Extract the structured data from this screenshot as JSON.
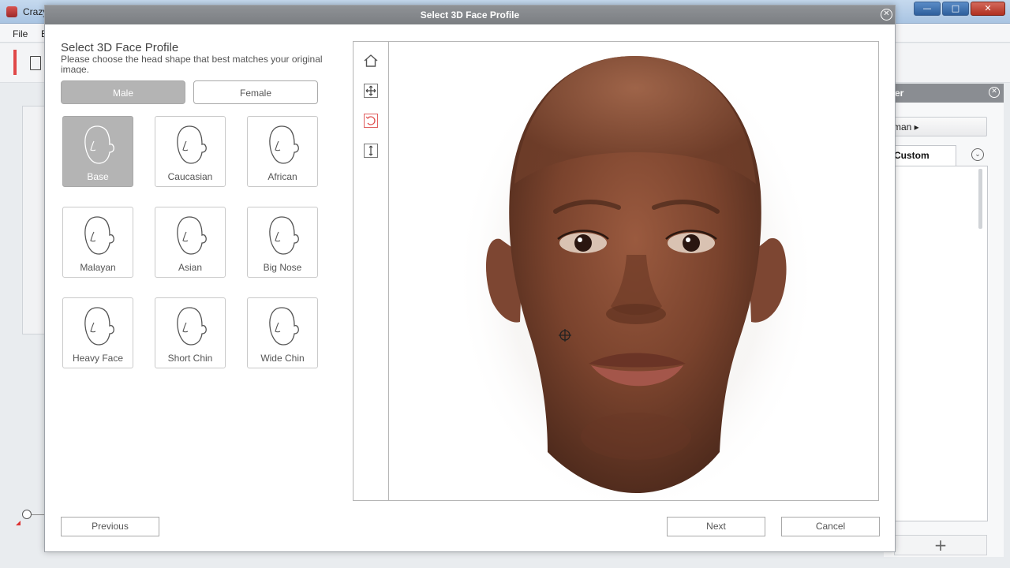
{
  "background_app": {
    "title": "Crazy",
    "menu": [
      "File",
      "E"
    ],
    "right_panel": {
      "title": "er",
      "dropdown_label": "man",
      "tab_label": "Custom"
    }
  },
  "dialog": {
    "title": "Select 3D Face Profile",
    "heading": "Select 3D Face Profile",
    "subheading": "Please choose the head shape that best matches your original image.",
    "gender": {
      "options": [
        "Male",
        "Female"
      ],
      "selected": "Male"
    },
    "profiles": [
      {
        "label": "Base",
        "selected": true
      },
      {
        "label": "Caucasian",
        "selected": false
      },
      {
        "label": "African",
        "selected": false
      },
      {
        "label": "Malayan",
        "selected": false
      },
      {
        "label": "Asian",
        "selected": false
      },
      {
        "label": "Big Nose",
        "selected": false
      },
      {
        "label": "Heavy Face",
        "selected": false
      },
      {
        "label": "Short Chin",
        "selected": false
      },
      {
        "label": "Wide Chin",
        "selected": false
      }
    ],
    "viewport_tools": [
      "home-icon",
      "pan-icon",
      "rotate-icon",
      "zoom-icon"
    ],
    "active_tool": "rotate-icon",
    "buttons": {
      "previous": "Previous",
      "next": "Next",
      "cancel": "Cancel"
    }
  },
  "colors": {
    "accent_red": "#e04848",
    "selected_gray": "#b4b4b4",
    "titlebar_gray": "#858889"
  }
}
